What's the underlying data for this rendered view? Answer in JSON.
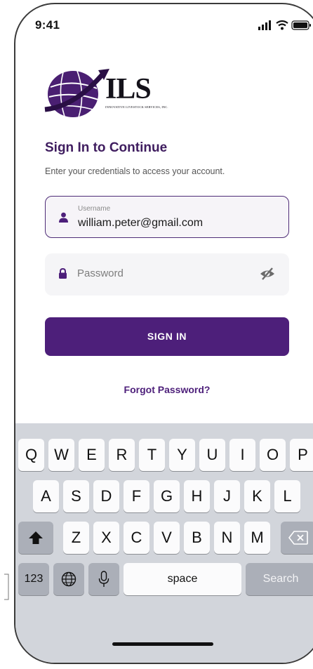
{
  "status_bar": {
    "time": "9:41"
  },
  "brand": {
    "name": "ILS",
    "tagline": "INNOVATIVE LIVESTOCK SERVICES, INC."
  },
  "login": {
    "title": "Sign In to Continue",
    "subtitle": "Enter your credentials to access your account.",
    "username": {
      "label": "Username",
      "value": "william.peter@gmail.com"
    },
    "password": {
      "placeholder": "Password"
    },
    "signin_label": "SIGN IN",
    "forgot_label": "Forgot Password?"
  },
  "keyboard": {
    "row1": [
      "Q",
      "W",
      "E",
      "R",
      "T",
      "Y",
      "U",
      "I",
      "O",
      "P"
    ],
    "row2": [
      "A",
      "S",
      "D",
      "F",
      "G",
      "H",
      "J",
      "K",
      "L"
    ],
    "row3": [
      "Z",
      "X",
      "C",
      "V",
      "B",
      "N",
      "M"
    ],
    "numbers_label": "123",
    "space_label": "space",
    "search_label": "Search"
  },
  "colors": {
    "brand_purple": "#4d1f7a",
    "title_purple": "#3f1d5f",
    "keyboard_bg": "#d2d5db"
  },
  "icons": [
    "signal-icon",
    "wifi-icon",
    "battery-icon",
    "globe-logo-icon",
    "user-icon",
    "lock-icon",
    "eye-off-icon",
    "shift-icon",
    "delete-icon",
    "globe-icon",
    "microphone-icon"
  ]
}
